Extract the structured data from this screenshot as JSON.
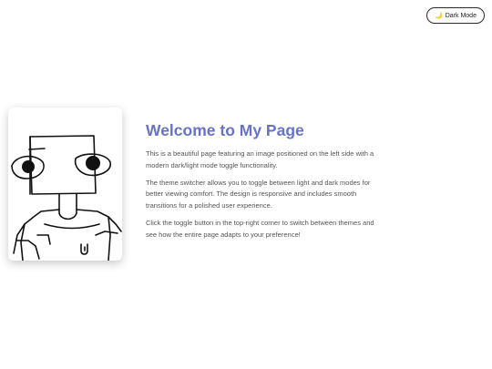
{
  "theme_toggle": {
    "icon": "moon-icon",
    "glyph": "🌙",
    "label": "Dark Mode"
  },
  "image": {
    "description_icon": "robot-drawing"
  },
  "main": {
    "title": "Welcome to My Page",
    "paragraphs": [
      "This is a beautiful page featuring an image positioned on the left side with a modern dark/light mode toggle functionality.",
      "The theme switcher allows you to toggle between light and dark modes for better viewing comfort. The design is responsive and includes smooth transitions for a polished user experience.",
      "Click the toggle button in the top-right corner to switch between themes and see how the entire page adapts to your preference!"
    ]
  },
  "colors": {
    "title": "#6673c9",
    "text": "#555555",
    "background": "#ffffff"
  }
}
